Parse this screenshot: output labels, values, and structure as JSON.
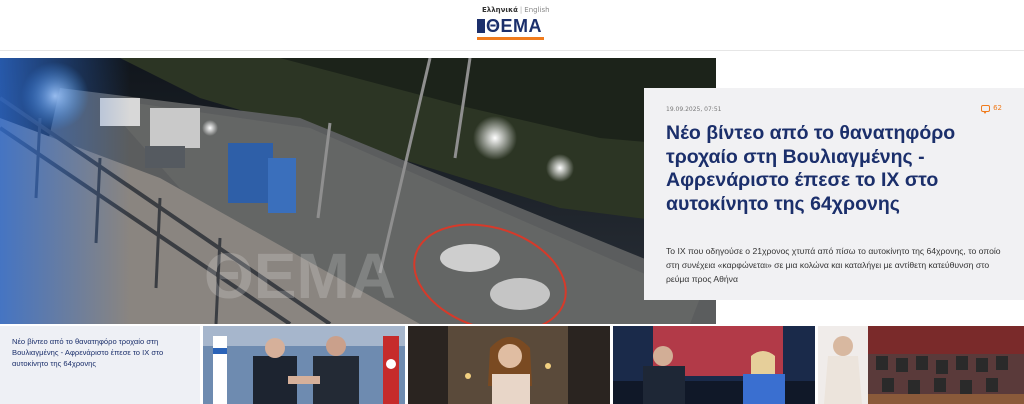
{
  "header": {
    "lang_active": "Ελληνικά",
    "lang_separator": "|",
    "lang_other": "English",
    "logo_text": "ΘΕΜΑ"
  },
  "hero": {
    "watermark": "ΘΕΜΑ",
    "date": "19.09.2025, 07:51",
    "comments_count": "62",
    "title": "Νέο βίντεο από το θανατηφόρο τροχαίο στη Βουλιαγμένης - Αφρενάριστο έπεσε το ΙΧ στο αυτοκίνητο της 64χρονης",
    "summary": "Το ΙΧ που οδηγούσε ο 21χρονος χτυπά από πίσω το αυτοκίνητο της 64χρονης, το οποίο στη συνέχεια «καρφώνεται» σε μια κολώνα και καταλήγει με αντίθετη κατεύθυνση στο ρεύμα προς Αθήνα"
  },
  "strip": {
    "first_title": "Νέο βίντεο από το θανατηφόρο τροχαίο στη Βουλιαγμένης - Αφρενάριστο έπεσε το ΙΧ στο αυτοκίνητο της 64χρονης"
  },
  "colors": {
    "brand_navy": "#1b2f6b",
    "brand_orange": "#f07b1c",
    "panel_bg": "#f1f1f3"
  }
}
